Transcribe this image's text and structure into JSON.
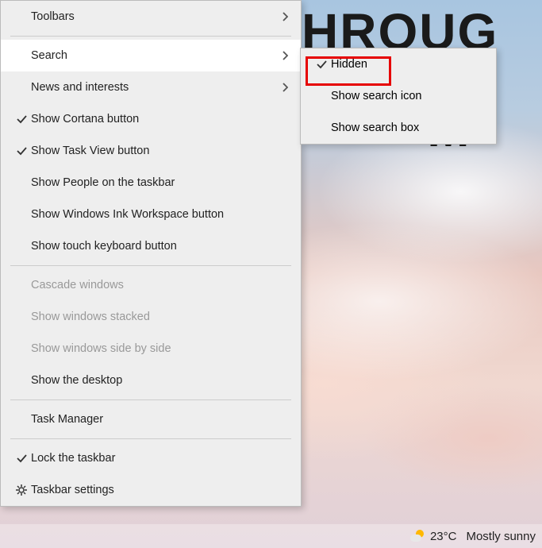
{
  "wallpaper_text_line1": "HROUG",
  "wallpaper_text_line2": "M",
  "main_menu": {
    "toolbars": "Toolbars",
    "search": "Search",
    "news": "News and interests",
    "cortana": "Show Cortana button",
    "taskview": "Show Task View button",
    "people": "Show People on the taskbar",
    "ink": "Show Windows Ink Workspace button",
    "touchkb": "Show touch keyboard button",
    "cascade": "Cascade windows",
    "stacked": "Show windows stacked",
    "sidebyside": "Show windows side by side",
    "desktop": "Show the desktop",
    "taskmgr": "Task Manager",
    "locktb": "Lock the taskbar",
    "settings": "Taskbar settings"
  },
  "sub_menu": {
    "hidden": "Hidden",
    "showicon": "Show search icon",
    "showbox": "Show search box"
  },
  "taskbar": {
    "temp": "23°C",
    "condition": "Mostly sunny"
  }
}
